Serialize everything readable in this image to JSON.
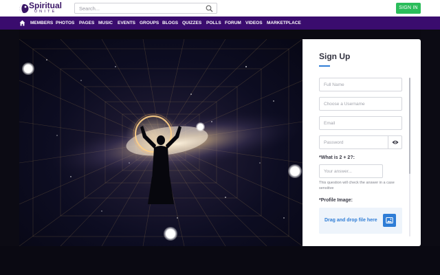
{
  "header": {
    "logo_text": "Spiritual",
    "logo_subtext": "UNITE",
    "search_placeholder": "Search...",
    "signin_label": "SIGN IN"
  },
  "nav": {
    "items": [
      "MEMBERS",
      "PHOTOS",
      "PAGES",
      "MUSIC",
      "EVENTS",
      "GROUPS",
      "BLOGS",
      "QUIZZES",
      "POLLS",
      "FORUM",
      "VIDEOS",
      "MARKETPLACE"
    ]
  },
  "signup": {
    "title": "Sign Up",
    "fullname_placeholder": "Full Name",
    "username_placeholder": "Choose a Username",
    "email_placeholder": "Email",
    "password_placeholder": "Password",
    "captcha_label": "*What is 2 + 2?:",
    "captcha_placeholder": "Your answer...",
    "captcha_hint": "This question will check the answer in a case sensitive",
    "profile_label": "*Profile Image:",
    "dropzone_text": "Drag and drop file here"
  },
  "colors": {
    "nav_bg": "#3a0c6e",
    "signin_bg": "#2bbd5b",
    "accent_blue": "#2f7dd6",
    "logo_purple": "#3a1566"
  },
  "icons": {
    "home": "home-icon",
    "search": "search-icon",
    "password_toggle": "eye-icon",
    "upload": "image-icon"
  }
}
